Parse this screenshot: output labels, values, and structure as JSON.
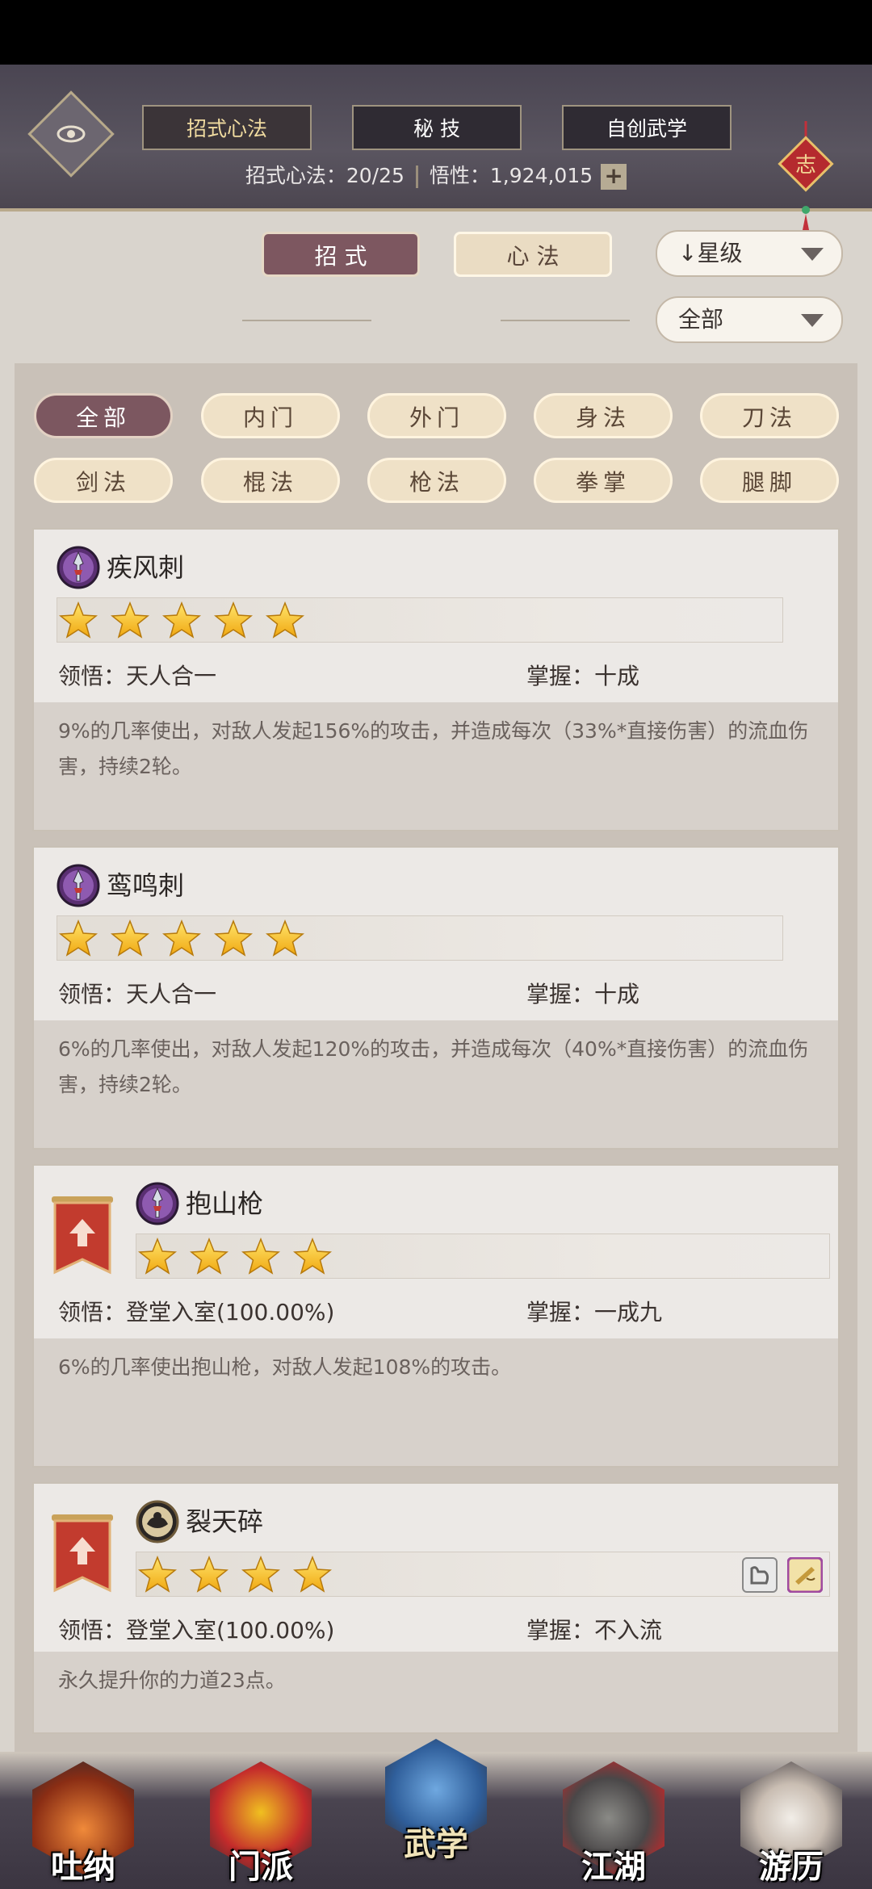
{
  "header": {
    "tabs": [
      {
        "label": "招式心法",
        "active": true
      },
      {
        "label": "秘 技",
        "active": false
      },
      {
        "label": "自创武学",
        "active": false
      }
    ],
    "info_count": "招式心法：20/25",
    "info_wuxing": "悟性：1,924,015",
    "plus_label": "+",
    "knot_char": "志"
  },
  "filters": {
    "segment_active": "招 式",
    "segment_inactive": "心 法",
    "sort_dropdown": "↓星级",
    "scope_dropdown": "全部"
  },
  "categories": [
    "全部",
    "内门",
    "外门",
    "身法",
    "刀法",
    "剑法",
    "棍法",
    "枪法",
    "拳掌",
    "腿脚"
  ],
  "active_category": "全部",
  "cards": [
    {
      "name": "疾风刺",
      "stars": 5,
      "insight": "领悟：天人合一",
      "mastery": "掌握：十成",
      "desc": "9%的几率使出，对敌人发起156%的攻击，并造成每次（33%*直接伤害）的流血伤害，持续2轮。",
      "icon": "spear-purple-icon",
      "has_upgrade": false
    },
    {
      "name": "鸾鸣刺",
      "stars": 5,
      "insight": "领悟：天人合一",
      "mastery": "掌握：十成",
      "desc": "6%的几率使出，对敌人发起120%的攻击，并造成每次（40%*直接伤害）的流血伤害，持续2轮。",
      "icon": "spear-purple-icon",
      "has_upgrade": false
    },
    {
      "name": "抱山枪",
      "stars": 4,
      "insight": "领悟：登堂入室(100.00%)",
      "mastery": "掌握：一成九",
      "desc": "6%的几率使出抱山枪，对敌人发起108%的攻击。",
      "icon": "spear-purple-icon",
      "has_upgrade": true
    },
    {
      "name": "裂天碎",
      "stars": 4,
      "insight": "领悟：登堂入室(100.00%)",
      "mastery": "掌握：不入流",
      "desc": "永久提升你的力道23点。",
      "icon": "strength-gold-icon",
      "has_upgrade": true
    }
  ],
  "nav": [
    {
      "label": "吐纳",
      "active": false
    },
    {
      "label": "门派",
      "active": false
    },
    {
      "label": "武学",
      "active": true
    },
    {
      "label": "江湖",
      "active": false
    },
    {
      "label": "游历",
      "active": false
    }
  ],
  "colors": {
    "header_bg": "#4f4a55",
    "accent_maroon": "#7d5760",
    "button_cream": "#efe1c7",
    "star_gold": "#f6c21a"
  }
}
